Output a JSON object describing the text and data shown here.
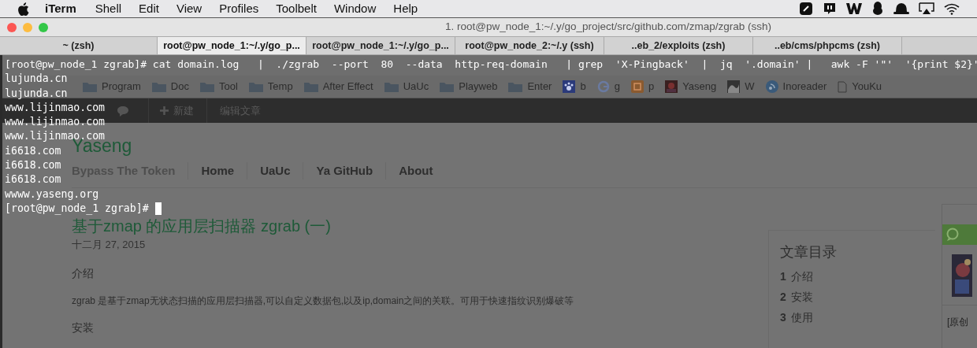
{
  "menu_bar": {
    "app": "iTerm",
    "items": [
      "Shell",
      "Edit",
      "View",
      "Profiles",
      "Toolbelt",
      "Window",
      "Help"
    ]
  },
  "window": {
    "title": "1. root@pw_node_1:~/.y/go_project/src/github.com/zmap/zgrab (ssh)",
    "tabs": [
      {
        "label": "~ (zsh)",
        "selected": false
      },
      {
        "label": "root@pw_node_1:~/.y/go_p...",
        "selected": true
      },
      {
        "label": "root@pw_node_1:~/.y/go_p...",
        "selected": false
      },
      {
        "label": "root@pw_node_2:~/.y (ssh)",
        "selected": false
      },
      {
        "label": "..eb_2/exploits (zsh)",
        "selected": false
      },
      {
        "label": "..eb/cms/phpcms (zsh)",
        "selected": false
      }
    ]
  },
  "terminal": {
    "prompt": "[root@pw_node_1 zgrab]#",
    "command": "cat domain.log   |  ./zgrab  --port  80  --data  http-req-domain   | grep  'X-Pingback'  |  jq  '.domain' |   awk -F '\"'  '{print $2}'",
    "output": [
      "lujunda.cn",
      "lujunda.cn",
      "www.lijinmao.com",
      "www.lijinmao.com",
      "www.lijinmao.com",
      "i6618.com",
      "i6618.com",
      "i6618.com",
      "wwww.yaseng.org"
    ],
    "last_prompt": "[root@pw_node_1 zgrab]#"
  },
  "browser": {
    "bookmarks": [
      {
        "label": "Program",
        "kind": "folder"
      },
      {
        "label": "Doc",
        "kind": "folder"
      },
      {
        "label": "Tool",
        "kind": "folder"
      },
      {
        "label": "Temp",
        "kind": "folder"
      },
      {
        "label": "After Effect",
        "kind": "folder"
      },
      {
        "label": "UaUc",
        "kind": "folder"
      },
      {
        "label": "Playweb",
        "kind": "folder"
      },
      {
        "label": "Enter",
        "kind": "folder"
      },
      {
        "label": "b",
        "kind": "paw"
      },
      {
        "label": "g",
        "kind": "g"
      },
      {
        "label": "p",
        "kind": "box"
      },
      {
        "label": "Yaseng"
      },
      {
        "label": "W",
        "kind": "wave"
      },
      {
        "label": "Inoreader",
        "kind": "feed"
      },
      {
        "label": "YouKu",
        "kind": "page"
      }
    ],
    "admin_bar": [
      "新建",
      "编辑文章"
    ],
    "site_title": "Yaseng",
    "nav": [
      {
        "label": "Bypass The Token",
        "selected": true
      },
      {
        "label": "Home",
        "selected": false
      },
      {
        "label": "UaUc",
        "selected": false
      },
      {
        "label": "Ya GitHub",
        "selected": false
      },
      {
        "label": "About",
        "selected": false
      }
    ],
    "post": {
      "title": "基于zmap 的应用层扫描器 zgrab (一)",
      "date": "十二月 27, 2015",
      "heading_1": "介绍",
      "paragraph": "zgrab 是基于zmap无状态扫描的应用层扫描器,可以自定义数据包,以及ip,domain之间的关联。可用于快速指纹识别爆破等",
      "heading_2": "安装"
    },
    "toc": {
      "title": "文章目录",
      "items": [
        {
          "number": "1",
          "label": "介绍"
        },
        {
          "number": "2",
          "label": "安装"
        },
        {
          "number": "3",
          "label": "使用"
        }
      ]
    },
    "sidebar_text": "[原创"
  }
}
